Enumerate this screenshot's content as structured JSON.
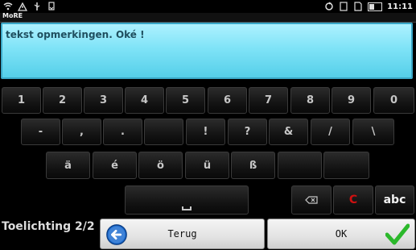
{
  "status_bar": {
    "left_icons": [
      "wifi-icon",
      "warning-icon",
      "usb-icon",
      "download-icon"
    ],
    "right_icons": [
      "sync-icon",
      "screen-icon",
      "sim-icon",
      "battery-icon"
    ],
    "time": "11:11"
  },
  "app": {
    "title": "MoRE"
  },
  "textarea": {
    "value": "tekst opmerkingen. Oké !"
  },
  "keyboard": {
    "row1": [
      "1",
      "2",
      "3",
      "4",
      "5",
      "6",
      "7",
      "8",
      "9",
      "0"
    ],
    "row2": [
      "-",
      ",",
      ".",
      "",
      "!",
      "?",
      "&",
      "/",
      "\\"
    ],
    "row3": [
      "ä",
      "é",
      "ö",
      "ü",
      "ß",
      "",
      ""
    ],
    "row4": {
      "space": "",
      "backspace": "",
      "clear": "C",
      "mode": "abc"
    }
  },
  "footer": {
    "label": "Toelichting 2/2",
    "back_button": "Terug",
    "ok_button": "OK"
  },
  "colors": {
    "ok_check": "#2bb82b",
    "back_circle": "#1f6ed1",
    "text_area": "#7fe3f7"
  }
}
